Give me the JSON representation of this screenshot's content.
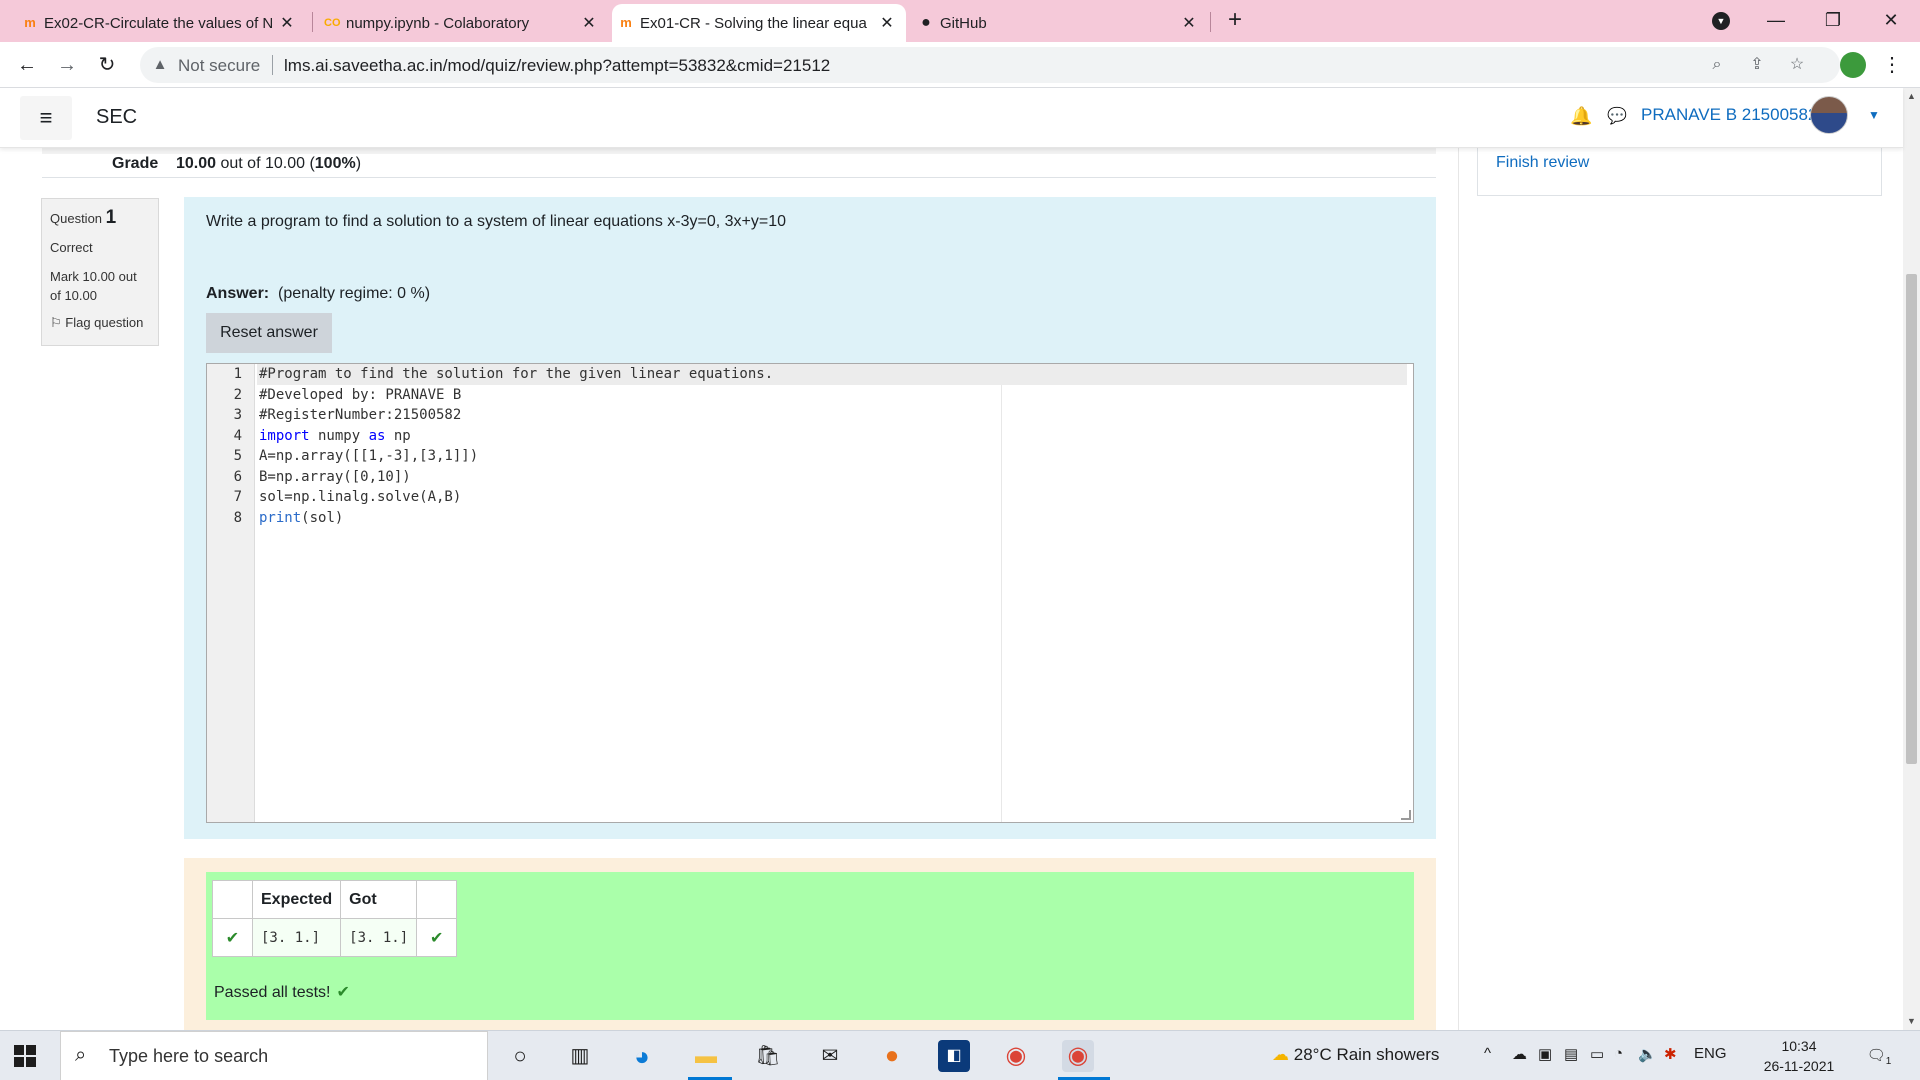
{
  "browser": {
    "tabs": [
      {
        "title": "Ex02-CR-Circulate the values of N",
        "icon": "moodle-icon",
        "fav": "m"
      },
      {
        "title": "numpy.ipynb - Colaboratory",
        "icon": "colab-icon",
        "fav": "CO"
      },
      {
        "title": "Ex01-CR - Solving the linear equa",
        "icon": "moodle-icon",
        "fav": "m"
      },
      {
        "title": "GitHub",
        "icon": "github-icon",
        "fav": "●"
      }
    ],
    "active_tab": 2,
    "not_secure": "Not secure",
    "url": "lms.ai.saveetha.ac.in/mod/quiz/review.php?attempt=53832&cmid=21512"
  },
  "navbar": {
    "site_name": "SEC",
    "user_name": "PRANAVE B 21500582"
  },
  "sidebar": {
    "finish_review": "Finish review"
  },
  "summary": {
    "grade_label": "Grade",
    "grade_value": "10.00",
    "grade_rest": " out of 10.00 (",
    "grade_pct": "100%",
    "grade_end": ")"
  },
  "question": {
    "label": "Question ",
    "number": "1",
    "state": "Correct",
    "mark": "Mark 10.00 out of 10.00",
    "flag": "Flag question",
    "text": "Write a program to find a solution to a system of linear equations x-3y=0, 3x+y=10",
    "answer_label": "Answer:",
    "penalty": "(penalty regime: 0 %)",
    "reset_button": "Reset answer",
    "code_line_numbers": [
      "1",
      "2",
      "3",
      "4",
      "5",
      "6",
      "7",
      "8"
    ]
  },
  "code": {
    "l1": "#Program to find the solution for the given linear equations.",
    "l2": "#Developed by: PRANAVE B",
    "l3": "#RegisterNumber:21500582",
    "l4_kw1": "import",
    "l4_mid": " numpy ",
    "l4_kw2": "as",
    "l4_end": " np",
    "l5": "A=np.array([[1,-3],[3,1]])",
    "l6": "B=np.array([0,10])",
    "l7": "sol=np.linalg.solve(A,B)",
    "l8_fn": "print",
    "l8_end": "(sol)"
  },
  "results": {
    "headers": [
      "Expected",
      "Got"
    ],
    "rows": [
      {
        "expected": "[3. 1.]",
        "got": "[3. 1.]"
      }
    ],
    "passed": "Passed all tests!"
  },
  "taskbar": {
    "search_placeholder": "Type here to search",
    "weather": "28°C  Rain showers",
    "lang": "ENG",
    "time": "10:34",
    "date": "26-11-2021",
    "notif_count": "1"
  },
  "colors": {
    "accent": "#0f6cbf",
    "question_bg": "#def2f8",
    "outcome_bg": "#fcefdc",
    "results_bg": "#aaffaa",
    "tabbar_bg": "#f5c9d9"
  }
}
